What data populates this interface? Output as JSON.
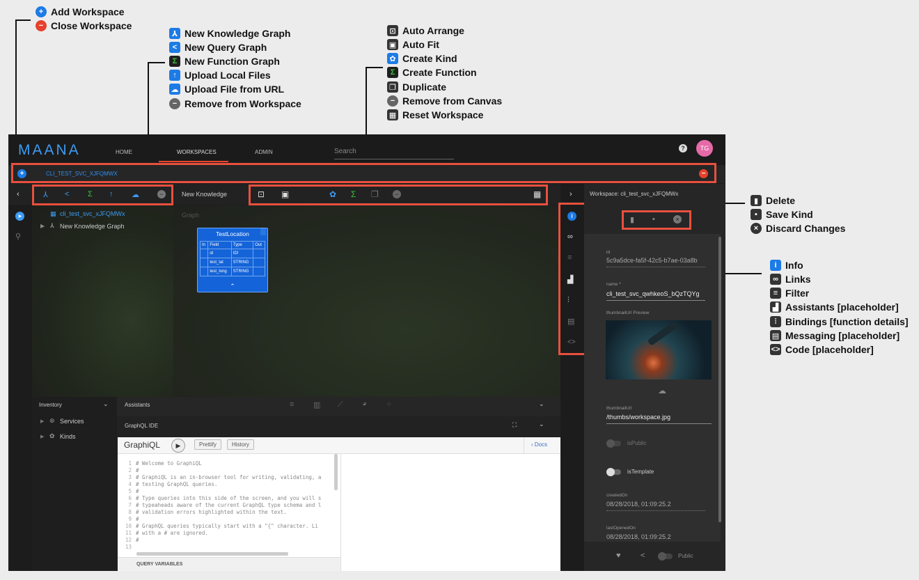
{
  "legend": {
    "workspace": [
      {
        "icon": "add-circle-icon",
        "label": "Add Workspace"
      },
      {
        "icon": "remove-circle-icon",
        "label": "Close Workspace"
      }
    ],
    "graph_tools": [
      {
        "icon": "knowledge-graph-icon",
        "label": "New Knowledge Graph"
      },
      {
        "icon": "query-graph-icon",
        "label": "New Query Graph"
      },
      {
        "icon": "function-graph-icon",
        "label": "New Function Graph"
      },
      {
        "icon": "upload-icon",
        "label": "Upload Local Files"
      },
      {
        "icon": "cloud-upload-icon",
        "label": "Upload File from URL"
      },
      {
        "icon": "remove-circle-icon",
        "label": "Remove from Workspace"
      }
    ],
    "canvas_tools": [
      {
        "icon": "auto-arrange-icon",
        "label": "Auto Arrange"
      },
      {
        "icon": "auto-fit-icon",
        "label": "Auto Fit"
      },
      {
        "icon": "create-kind-icon",
        "label": "Create Kind"
      },
      {
        "icon": "create-function-icon",
        "label": "Create Function"
      },
      {
        "icon": "duplicate-icon",
        "label": "Duplicate"
      },
      {
        "icon": "remove-circle-icon",
        "label": "Remove from Canvas"
      },
      {
        "icon": "reset-workspace-icon",
        "label": "Reset Workspace"
      }
    ],
    "kind_tools": [
      {
        "icon": "delete-icon",
        "label": "Delete"
      },
      {
        "icon": "save-icon",
        "label": "Save Kind"
      },
      {
        "icon": "discard-icon",
        "label": "Discard Changes"
      }
    ],
    "panel_tools": [
      {
        "icon": "info-icon",
        "label": "Info"
      },
      {
        "icon": "link-icon",
        "label": "Links"
      },
      {
        "icon": "filter-icon",
        "label": "Filter"
      },
      {
        "icon": "assistants-icon",
        "label": "Assistants [placeholder]"
      },
      {
        "icon": "bindings-icon",
        "label": "Bindings [function details]"
      },
      {
        "icon": "messaging-icon",
        "label": "Messaging [placeholder]"
      },
      {
        "icon": "code-icon",
        "label": "Code [placeholder]"
      }
    ]
  },
  "header": {
    "logo": "MAANA",
    "nav": {
      "home": "HOME",
      "workspaces": "WORKSPACES",
      "admin": "ADMIN"
    },
    "search_placeholder": "Search",
    "help": "?",
    "avatar": "TG"
  },
  "tabbar": {
    "workspace_tab": "CLI_TEST_SVC_XJFQMWX"
  },
  "canvas": {
    "title": "New Knowledge",
    "graph_label": "Graph"
  },
  "tree": {
    "workspace": "cli_test_svc_xJFQMWx",
    "graph": "New Knowledge Graph"
  },
  "kind_card": {
    "title": "TestLocation",
    "headers": [
      "In",
      "Field",
      "Type",
      "Out"
    ],
    "rows": [
      {
        "field": "id",
        "type": "ID!"
      },
      {
        "field": "test_lat",
        "type": "STRING"
      },
      {
        "field": "test_long",
        "type": "STRING"
      }
    ]
  },
  "inventory": {
    "title": "Inventory",
    "items": [
      "Services",
      "Kinds"
    ]
  },
  "assistants": {
    "title": "Assistants"
  },
  "graphql": {
    "title": "GraphQL IDE",
    "app_name": "GraphiQL",
    "prettify": "Prettify",
    "history": "History",
    "docs": "Docs",
    "query_variables": "QUERY VARIABLES",
    "lines": [
      "# Welcome to GraphiQL",
      "#",
      "# GraphiQL is an in-browser tool for writing, validating, a",
      "# testing GraphQL queries.",
      "#",
      "# Type queries into this side of the screen, and you will s",
      "# typeaheads aware of the current GraphQL type schema and l",
      "# validation errors highlighted within the text.",
      "#",
      "# GraphQL queries typically start with a \"{\" character. Li",
      "# with a # are ignored.",
      "#",
      ""
    ]
  },
  "panel": {
    "title": "Workspace: cli_test_svc_xJFQMWx",
    "id_label": "id",
    "id_value": "5c9a5dce-fa5f-42c5-b7ae-03a8b",
    "name_label": "name *",
    "name_value": "cli_test_svc_qwhkeoS_bQzTQYg",
    "thumbnail_preview_label": "thumbnailUrl Preview",
    "thumbnail_url_label": "thumbnailUrl",
    "thumbnail_url_value": "/thumbs/workspace.jpg",
    "is_public_label": "isPublic",
    "is_template_label": "isTemplate",
    "created_label": "createdOn",
    "created_value": "08/28/2018, 01:09:25.2",
    "last_opened_label": "lastOpenedOn",
    "last_opened_value": "08/28/2018, 01:09:25.2",
    "footer_public": "Public"
  },
  "colors": {
    "accent": "#1d7be6",
    "highlight": "#e8503e",
    "danger": "#e5412d",
    "green": "#3bc33b"
  }
}
